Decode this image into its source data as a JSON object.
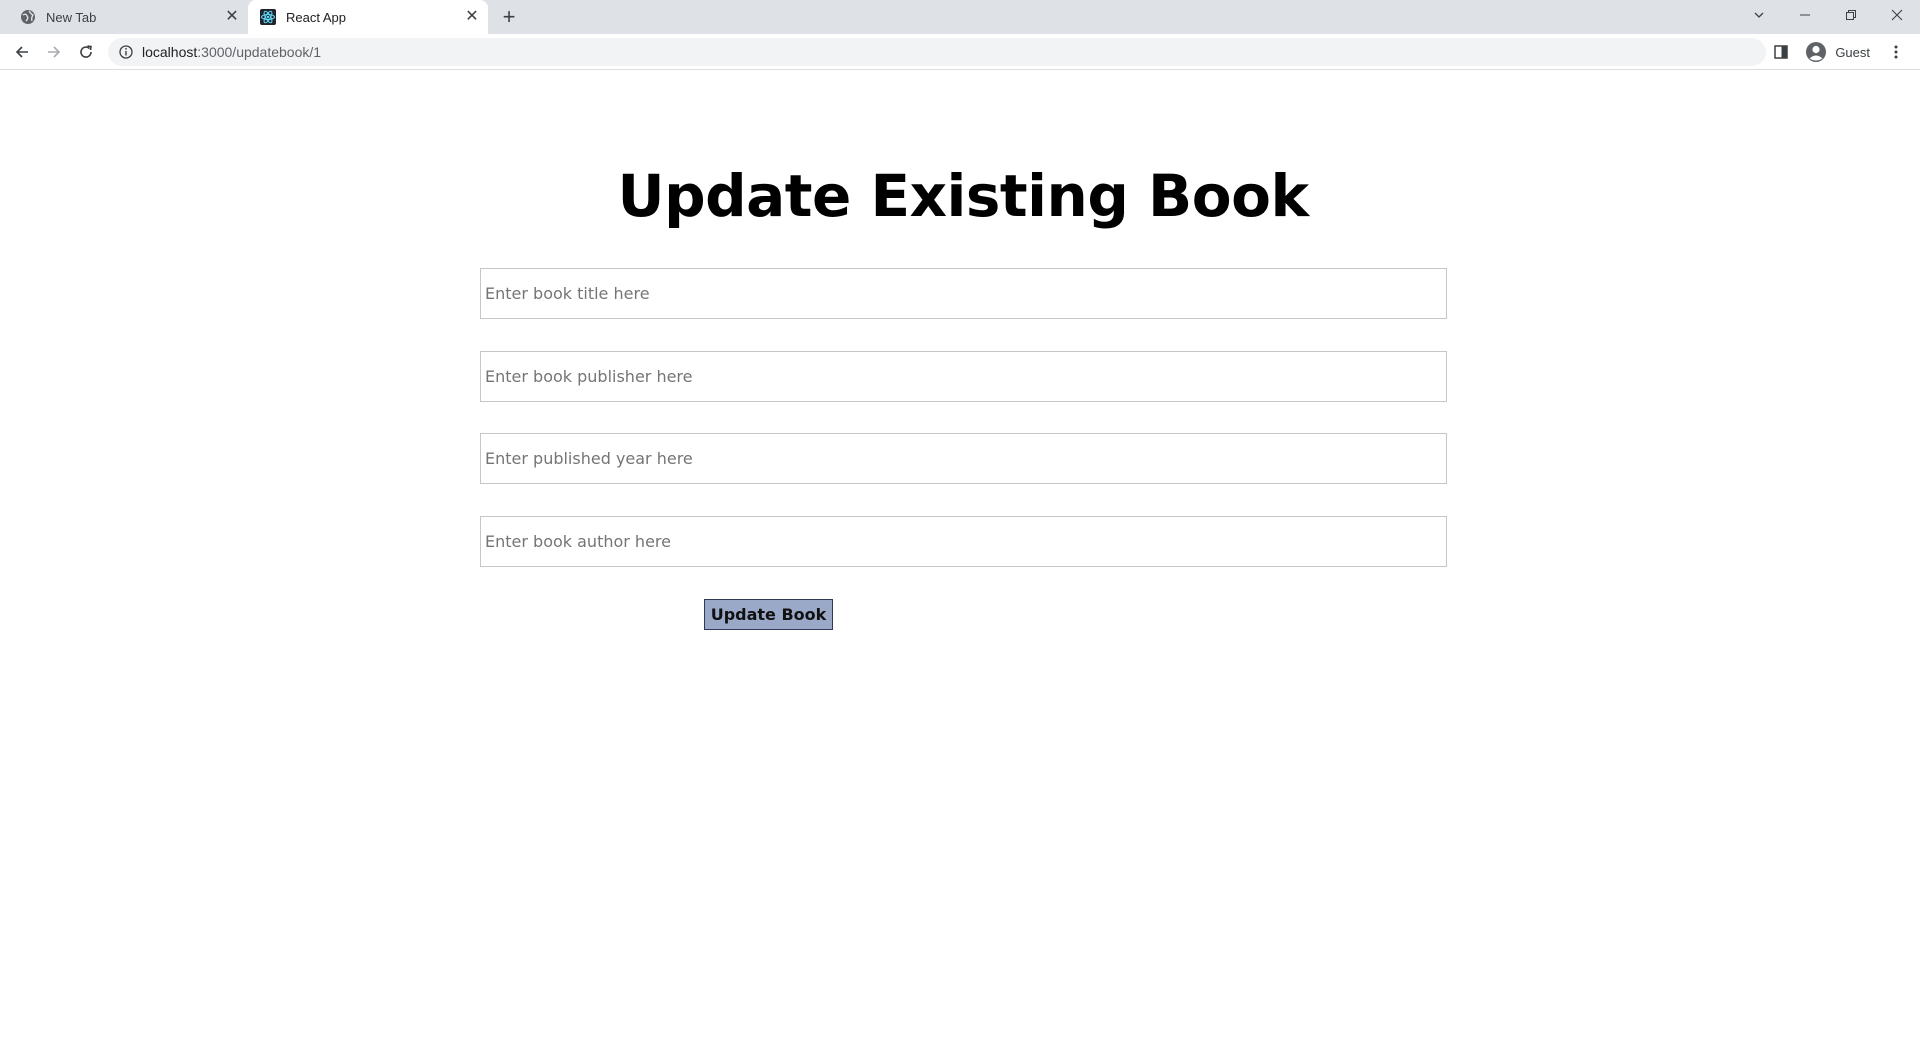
{
  "browser": {
    "tabs": [
      {
        "title": "New Tab",
        "active": false,
        "icon": "globe-icon"
      },
      {
        "title": "React App",
        "active": true,
        "icon": "react-icon"
      }
    ],
    "address_bar": {
      "host": "localhost",
      "path": ":3000/updatebook/1"
    },
    "profile_label": "Guest",
    "colors": {
      "tabstrip": "#dee1e6",
      "omnibox": "#f1f3f4"
    }
  },
  "page": {
    "title": "Update Existing Book",
    "fields": {
      "title_placeholder": "Enter book title here",
      "publisher_placeholder": "Enter book publisher here",
      "year_placeholder": "Enter published year here",
      "author_placeholder": "Enter book author here"
    },
    "submit_label": "Update Book",
    "colors": {
      "button_bg": "#9ba9c9",
      "button_border": "#2f3a57"
    }
  }
}
